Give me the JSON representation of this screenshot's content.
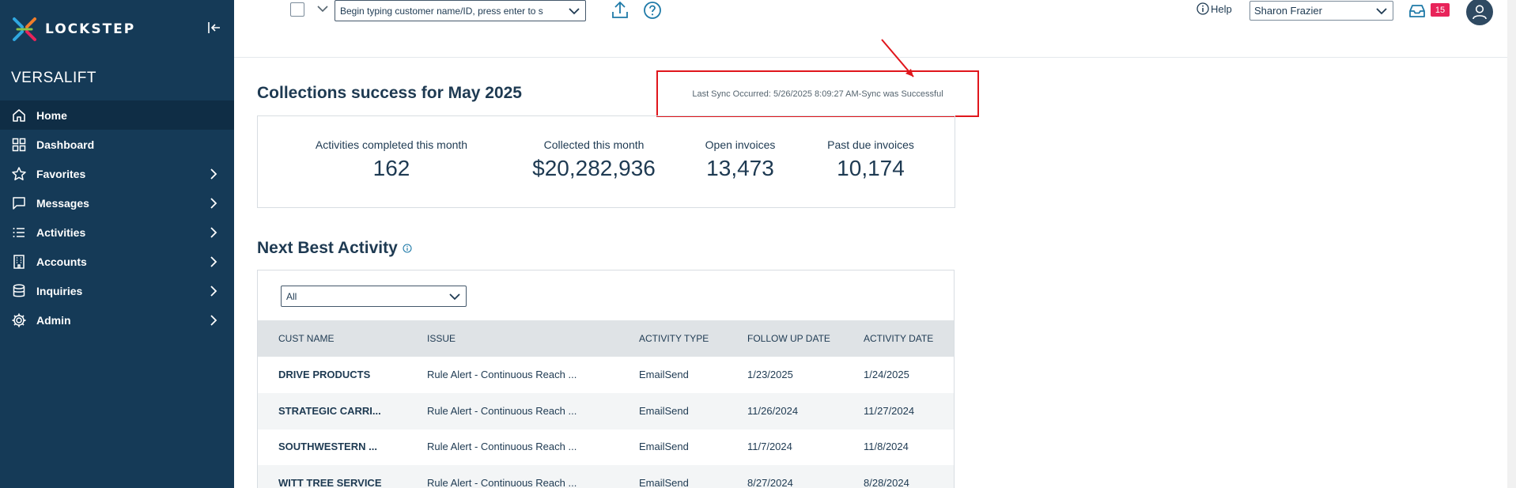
{
  "brand": {
    "logo_text": "LOCKSTEP",
    "tenant": "VERSALIFT"
  },
  "sidebar": {
    "items": [
      {
        "label": "Home",
        "icon": "home-icon",
        "active": true
      },
      {
        "label": "Dashboard",
        "icon": "dashboard-icon"
      },
      {
        "label": "Favorites",
        "icon": "star-icon"
      },
      {
        "label": "Messages",
        "icon": "message-icon"
      },
      {
        "label": "Activities",
        "icon": "list-icon"
      },
      {
        "label": "Accounts",
        "icon": "building-icon"
      },
      {
        "label": "Inquiries",
        "icon": "database-icon"
      },
      {
        "label": "Admin",
        "icon": "gear-icon"
      }
    ]
  },
  "topbar": {
    "search_placeholder": "Begin typing customer name/ID, press enter to s",
    "help_label": "Help",
    "user_name": "Sharon Frazier",
    "inbox_count": "15"
  },
  "main": {
    "title": "Collections success for May 2025",
    "sync_text": "Last Sync Occurred: 5/26/2025 8:09:27 AM-Sync was Successful",
    "stats": [
      {
        "label": "Activities completed this month",
        "value": "162"
      },
      {
        "label": "Collected this month",
        "value": "$20,282,936"
      },
      {
        "label": "Open invoices",
        "value": "13,473"
      },
      {
        "label": "Past due invoices",
        "value": "10,174"
      }
    ],
    "nba_title": "Next Best Activity",
    "filter_value": "All",
    "table": {
      "headers": [
        "CUST NAME",
        "ISSUE",
        "ACTIVITY TYPE",
        "FOLLOW UP DATE",
        "ACTIVITY DATE"
      ],
      "rows": [
        [
          "DRIVE PRODUCTS",
          "Rule Alert - Continuous Reach ...",
          "EmailSend",
          "1/23/2025",
          "1/24/2025"
        ],
        [
          "STRATEGIC CARRI...",
          "Rule Alert - Continuous Reach ...",
          "EmailSend",
          "11/26/2024",
          "11/27/2024"
        ],
        [
          "SOUTHWESTERN ...",
          "Rule Alert - Continuous Reach ...",
          "EmailSend",
          "11/7/2024",
          "11/8/2024"
        ],
        [
          "WITT TREE SERVICE",
          "Rule Alert - Continuous Reach ...",
          "EmailSend",
          "8/27/2024",
          "8/28/2024"
        ]
      ]
    }
  },
  "colors": {
    "sidebar_bg": "#153a57",
    "accent_red": "#e0161c",
    "badge": "#e8245a"
  }
}
